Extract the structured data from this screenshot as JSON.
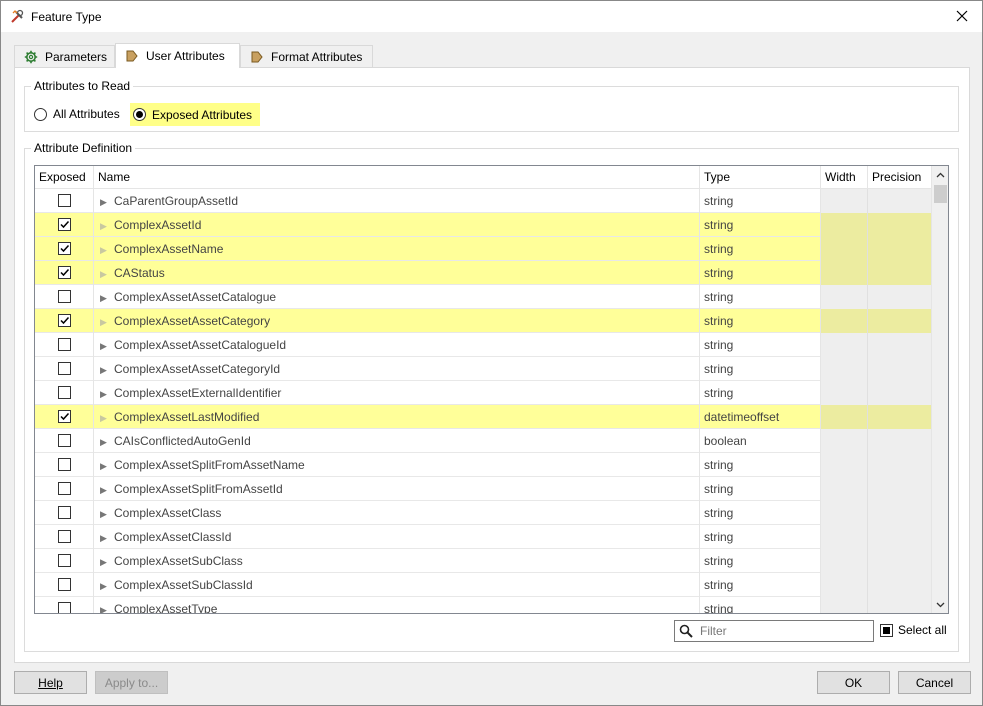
{
  "window": {
    "title": "Feature Type"
  },
  "tabs": [
    {
      "label": "Parameters",
      "icon": "gear-icon"
    },
    {
      "label": "User Attributes",
      "icon": "arrow-tag-icon"
    },
    {
      "label": "Format Attributes",
      "icon": "arrow-tag-icon"
    }
  ],
  "attributes_to_read": {
    "title": "Attributes to Read",
    "options": [
      "All Attributes",
      "Exposed Attributes"
    ],
    "selected": "Exposed Attributes"
  },
  "attribute_definition": {
    "title": "Attribute Definition",
    "columns": [
      "Exposed",
      "Name",
      "Type",
      "Width",
      "Precision"
    ],
    "rows": [
      {
        "exposed": false,
        "name": "CaParentGroupAssetId",
        "type": "string"
      },
      {
        "exposed": true,
        "name": "ComplexAssetId",
        "type": "string"
      },
      {
        "exposed": true,
        "name": "ComplexAssetName",
        "type": "string"
      },
      {
        "exposed": true,
        "name": "CAStatus",
        "type": "string"
      },
      {
        "exposed": false,
        "name": "ComplexAssetAssetCatalogue",
        "type": "string"
      },
      {
        "exposed": true,
        "name": "ComplexAssetAssetCategory",
        "type": "string"
      },
      {
        "exposed": false,
        "name": "ComplexAssetAssetCatalogueId",
        "type": "string"
      },
      {
        "exposed": false,
        "name": "ComplexAssetAssetCategoryId",
        "type": "string"
      },
      {
        "exposed": false,
        "name": "ComplexAssetExternalIdentifier",
        "type": "string"
      },
      {
        "exposed": true,
        "name": "ComplexAssetLastModified",
        "type": "datetimeoffset"
      },
      {
        "exposed": false,
        "name": "CAIsConflictedAutoGenId",
        "type": "boolean"
      },
      {
        "exposed": false,
        "name": "ComplexAssetSplitFromAssetName",
        "type": "string"
      },
      {
        "exposed": false,
        "name": "ComplexAssetSplitFromAssetId",
        "type": "string"
      },
      {
        "exposed": false,
        "name": "ComplexAssetClass",
        "type": "string"
      },
      {
        "exposed": false,
        "name": "ComplexAssetClassId",
        "type": "string"
      },
      {
        "exposed": false,
        "name": "ComplexAssetSubClass",
        "type": "string"
      },
      {
        "exposed": false,
        "name": "ComplexAssetSubClassId",
        "type": "string"
      },
      {
        "exposed": false,
        "name": "ComplexAssetType",
        "type": "string"
      }
    ]
  },
  "filter": {
    "placeholder": "Filter",
    "value": ""
  },
  "select_all": {
    "label": "Select all"
  },
  "buttons": {
    "help": "Help",
    "apply": "Apply to...",
    "ok": "OK",
    "cancel": "Cancel"
  },
  "colors": {
    "highlight": "#ffff99",
    "readonly_cell": "#eeeeee"
  }
}
